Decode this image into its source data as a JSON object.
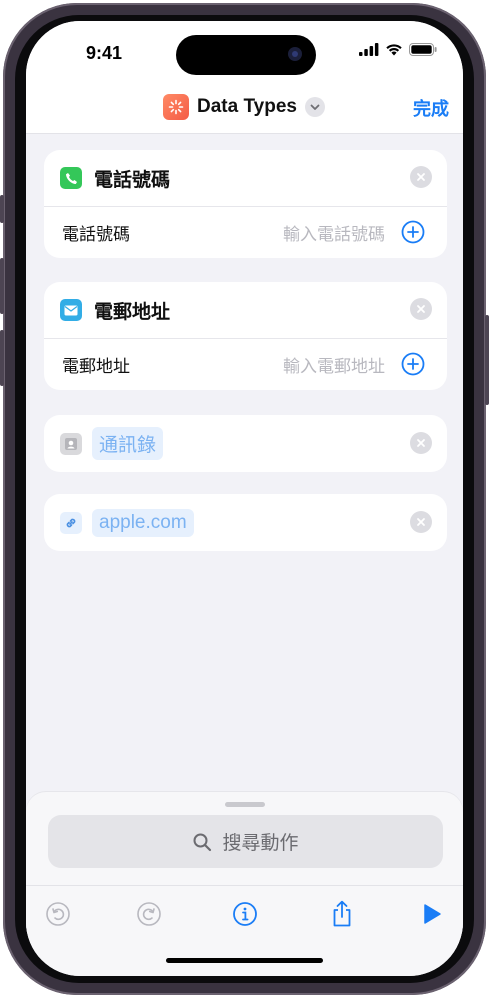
{
  "status_bar": {
    "time": "9:41"
  },
  "header": {
    "title": "Data Types",
    "done_label": "完成"
  },
  "cards": {
    "phone": {
      "title": "電話號碼",
      "row_label": "電話號碼",
      "placeholder": "輸入電話號碼"
    },
    "email": {
      "title": "電郵地址",
      "row_label": "電郵地址",
      "placeholder": "輸入電郵地址"
    },
    "contacts": {
      "token": "通訊錄"
    },
    "url": {
      "token": "apple.com"
    }
  },
  "search": {
    "placeholder": "搜尋動作"
  },
  "colors": {
    "accent": "#1a7df6",
    "phone_badge": "#34c759",
    "mail_badge": "#32ade6",
    "token_bg": "#e6f0fd"
  },
  "icons": [
    "phone-icon",
    "mail-icon",
    "contacts-icon",
    "link-icon",
    "close-icon",
    "plus-circle-icon",
    "search-icon",
    "undo-icon",
    "redo-icon",
    "info-icon",
    "share-icon",
    "play-icon"
  ]
}
